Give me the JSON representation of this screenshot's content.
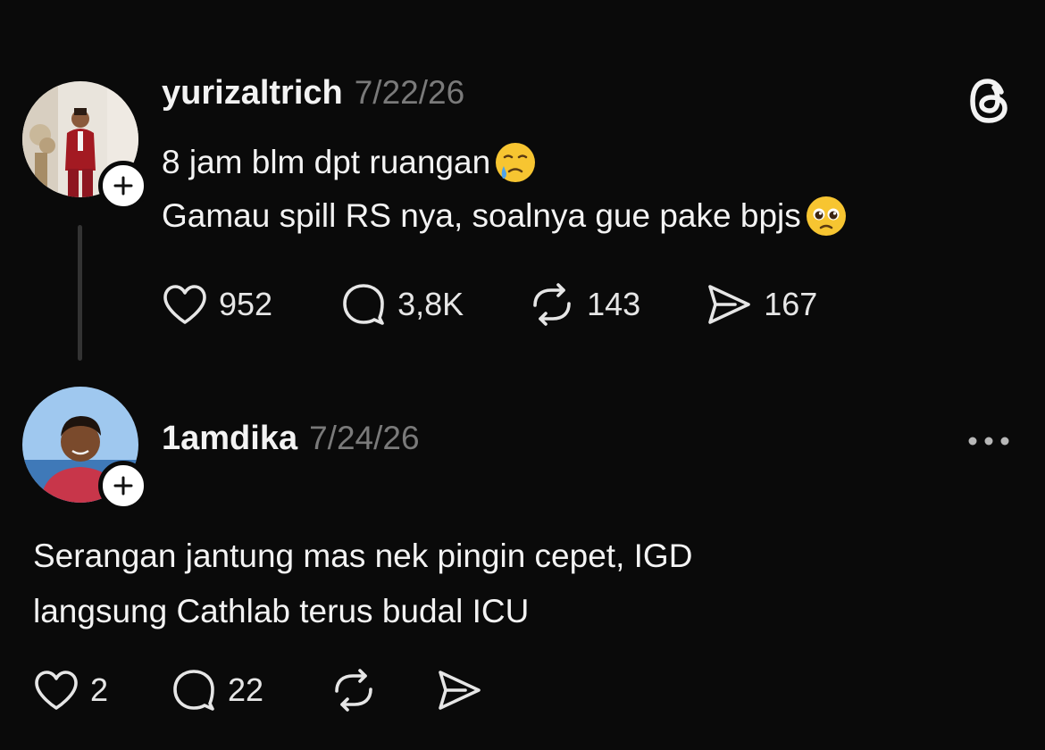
{
  "post": {
    "username": "yurizaltrich",
    "timestamp": "7/22/26",
    "lines": [
      "8 jam blm dpt ruangan",
      "Gamau spill RS nya, soalnya gue pake bpjs"
    ],
    "emojis": [
      "face-holding-back-tears-icon",
      "pleading-face-icon"
    ],
    "actions": {
      "likes": "952",
      "replies": "3,8K",
      "reposts": "143",
      "shares": "167"
    }
  },
  "reply": {
    "username": "1amdika",
    "timestamp": "7/24/26",
    "lines": [
      "Serangan jantung mas nek pingin cepet, IGD",
      "langsung Cathlab terus budal ICU"
    ],
    "actions": {
      "likes": "2",
      "replies": "22"
    }
  },
  "icons": {
    "app_logo": "threads-logo-icon",
    "more": "more-options-icon",
    "follow": "plus-icon"
  },
  "colors": {
    "background": "#0a0a0a",
    "text": "#f3f3f3",
    "muted": "#7a7a7a",
    "thread_line": "#333333"
  }
}
